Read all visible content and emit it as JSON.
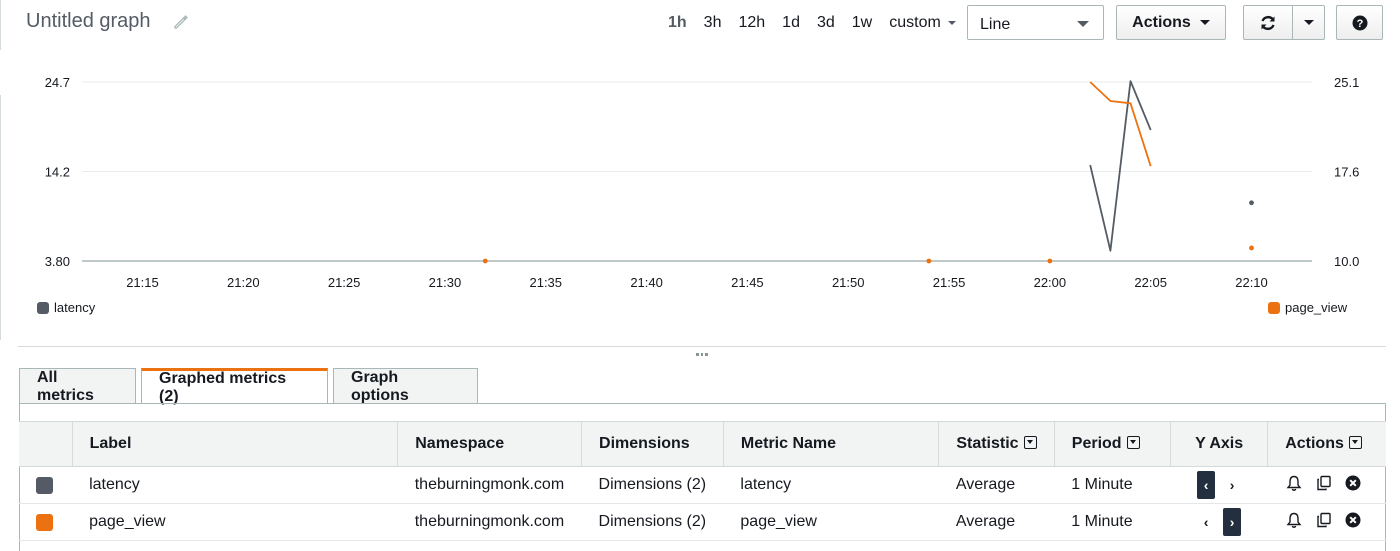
{
  "header": {
    "title": "Untitled graph",
    "ranges": [
      "1h",
      "3h",
      "12h",
      "1d",
      "3d",
      "1w"
    ],
    "active_range": "1h",
    "custom_label": "custom",
    "view_select": "Line",
    "actions_label": "Actions"
  },
  "chart_data": {
    "type": "line",
    "x_ticks": [
      "21:15",
      "21:20",
      "21:25",
      "21:30",
      "21:35",
      "21:40",
      "21:45",
      "21:50",
      "21:55",
      "22:00",
      "22:05",
      "22:10"
    ],
    "x_range": [
      "21:12",
      "22:13"
    ],
    "y_left": {
      "ticks": [
        "3.80",
        "14.2",
        "24.7"
      ],
      "range": [
        3.8,
        24.7
      ]
    },
    "y_right": {
      "ticks": [
        "10.0",
        "17.6",
        "25.1"
      ],
      "range": [
        10.0,
        25.1
      ]
    },
    "grid": "horizontal",
    "series": [
      {
        "name": "latency",
        "axis": "left",
        "color": "#545b64",
        "segments": [
          [
            [
              "22:02",
              15.0
            ],
            [
              "22:03",
              5.0
            ],
            [
              "22:04",
              24.8
            ],
            [
              "22:05",
              19.1
            ]
          ]
        ],
        "points": [
          [
            "22:10",
            10.6
          ]
        ]
      },
      {
        "name": "page_view",
        "axis": "right",
        "color": "#ec7211",
        "segments": [
          [
            [
              "22:02",
              25.1
            ],
            [
              "22:03",
              23.5
            ],
            [
              "22:04",
              23.3
            ],
            [
              "22:05",
              18.0
            ]
          ]
        ],
        "points": [
          [
            "21:32",
            10.0
          ],
          [
            "21:54",
            10.0
          ],
          [
            "22:00",
            10.0
          ],
          [
            "22:10",
            11.1
          ]
        ]
      }
    ],
    "legend": {
      "left": "latency",
      "right": "page_view"
    }
  },
  "tabs": [
    {
      "label": "All metrics",
      "active": false
    },
    {
      "label": "Graphed metrics (2)",
      "active": true
    },
    {
      "label": "Graph options",
      "active": false
    }
  ],
  "table": {
    "headers": {
      "label": "Label",
      "namespace": "Namespace",
      "dimensions": "Dimensions",
      "metric": "Metric Name",
      "statistic": "Statistic",
      "period": "Period",
      "yaxis": "Y Axis",
      "actions": "Actions"
    },
    "rows": [
      {
        "color": "#545b64",
        "label": "latency",
        "namespace": "theburningmonk.com",
        "dimensions": "Dimensions (2)",
        "metric": "latency",
        "statistic": "Average",
        "period": "1 Minute",
        "yaxis": "left"
      },
      {
        "color": "#ec7211",
        "label": "page_view",
        "namespace": "theburningmonk.com",
        "dimensions": "Dimensions (2)",
        "metric": "page_view",
        "statistic": "Average",
        "period": "1 Minute",
        "yaxis": "right"
      }
    ]
  }
}
